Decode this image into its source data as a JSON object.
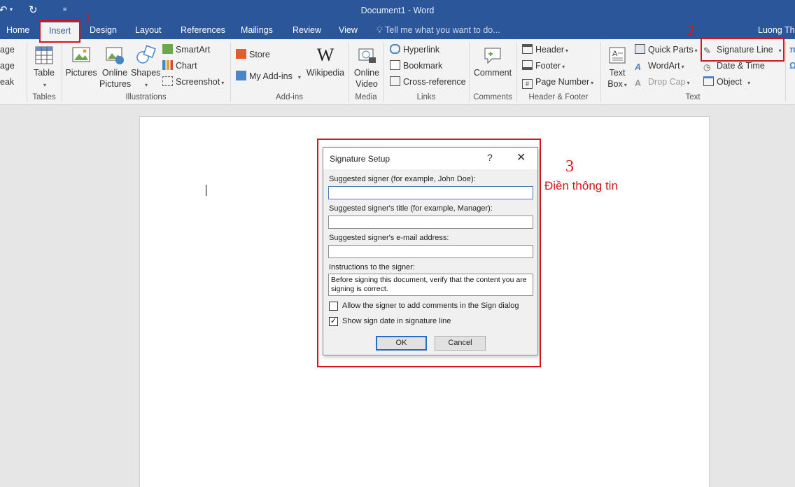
{
  "window": {
    "title": "Document1 - Word",
    "user": "Luong Thi"
  },
  "tabs": [
    {
      "label": "Home"
    },
    {
      "label": "Insert"
    },
    {
      "label": "Design"
    },
    {
      "label": "Layout"
    },
    {
      "label": "References"
    },
    {
      "label": "Mailings"
    },
    {
      "label": "Review"
    },
    {
      "label": "View"
    }
  ],
  "active_tab": "Insert",
  "tell_me_placeholder": "Tell me what you want to do...",
  "ribbon": {
    "pages": {
      "items": [
        "age",
        "age",
        "eak"
      ]
    },
    "tables": {
      "label": "Tables",
      "table": "Table"
    },
    "illustrations": {
      "label": "Illustrations",
      "pictures": "Pictures",
      "online_pictures_1": "Online",
      "online_pictures_2": "Pictures",
      "shapes": "Shapes",
      "smartart": "SmartArt",
      "chart": "Chart",
      "screenshot": "Screenshot"
    },
    "addins": {
      "label": "Add-ins",
      "store": "Store",
      "my_addins": "My Add-ins",
      "wikipedia": "Wikipedia"
    },
    "media": {
      "label": "Media",
      "online_video_1": "Online",
      "online_video_2": "Video"
    },
    "links": {
      "label": "Links",
      "hyperlink": "Hyperlink",
      "bookmark": "Bookmark",
      "cross_reference": "Cross-reference"
    },
    "comments": {
      "label": "Comments",
      "comment": "Comment"
    },
    "header_footer": {
      "label": "Header & Footer",
      "header": "Header",
      "footer": "Footer",
      "page_number": "Page Number"
    },
    "text": {
      "label": "Text",
      "text_box_1": "Text",
      "text_box_2": "Box",
      "quick_parts": "Quick Parts",
      "wordart": "WordArt",
      "drop_cap": "Drop Cap",
      "signature_line": "Signature Line",
      "date_time": "Date & Time",
      "object": "Object"
    }
  },
  "annotations": {
    "step1": "1",
    "step2": "2",
    "step3": "3",
    "step3_text": "Điền thông tin"
  },
  "dialog": {
    "title": "Signature Setup",
    "help": "?",
    "close": "✕",
    "signer_label": "Suggested signer (for example, John Doe):",
    "signer_value": "",
    "title_label": "Suggested signer's title (for example, Manager):",
    "title_value": "",
    "email_label": "Suggested signer's e-mail address:",
    "email_value": "",
    "instructions_label": "Instructions to the signer:",
    "instructions_value": "Before signing this document, verify that the content you are signing is correct.",
    "allow_comments_label": "Allow the signer to add comments in the Sign dialog",
    "allow_comments_checked": false,
    "show_date_label": "Show sign date in signature line",
    "show_date_checked": true,
    "ok": "OK",
    "cancel": "Cancel"
  },
  "colors": {
    "accent": "#2b579a",
    "annotation": "#d4161c"
  }
}
